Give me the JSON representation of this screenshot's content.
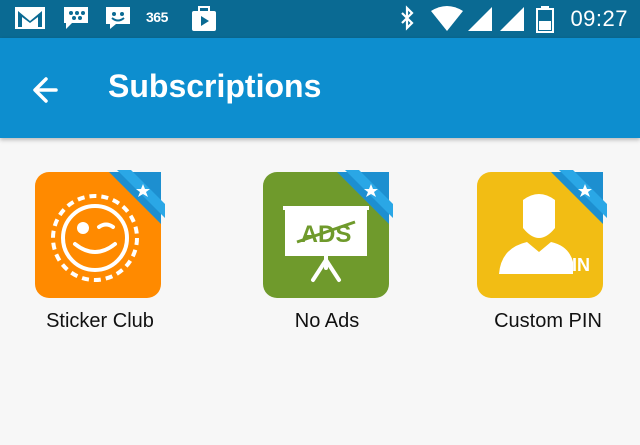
{
  "status_bar": {
    "time": "09:27",
    "icons": [
      "gmail-icon",
      "bbm-icon",
      "messenger-icon",
      "365-icon",
      "media-icon",
      "bluetooth-icon",
      "wifi-icon",
      "signal-icon",
      "signal-icon",
      "battery-icon"
    ],
    "label_365": "365"
  },
  "app_bar": {
    "title": "Subscriptions",
    "back_icon": "arrow-left-icon"
  },
  "subscriptions": [
    {
      "label": "Sticker Club",
      "icon": "sticker-face-icon",
      "color": "#ff8a00"
    },
    {
      "label": "No Ads",
      "icon": "no-ads-board-icon",
      "color": "#6f9a2c",
      "icon_text": "ADS"
    },
    {
      "label": "Custom PIN",
      "icon": "person-pin-icon",
      "color": "#f2bd14",
      "icon_text": "PIN"
    }
  ],
  "colors": {
    "status_bar": "#0a6a93",
    "app_bar": "#0d8ecf",
    "ribbon": "#1d8fd0",
    "background": "#f7f7f7"
  }
}
